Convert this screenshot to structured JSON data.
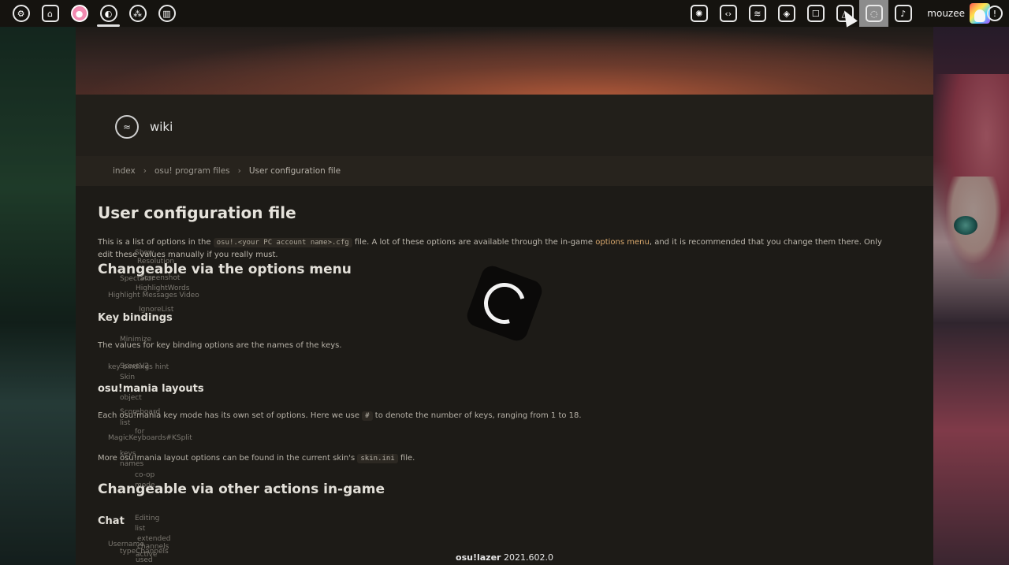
{
  "toolbar": {
    "left_buttons": [
      {
        "name": "settings-button",
        "icon": "gear-icon",
        "glyph": "⚙"
      },
      {
        "name": "home-button",
        "icon": "home-icon",
        "glyph": "⌂"
      },
      {
        "name": "ruleset-osu-button",
        "icon": "osu-ruleset-icon",
        "glyph": "●"
      },
      {
        "name": "ruleset-taiko-button",
        "icon": "taiko-ruleset-icon",
        "glyph": "◐"
      },
      {
        "name": "ruleset-catch-button",
        "icon": "catch-ruleset-icon",
        "glyph": "⁂"
      },
      {
        "name": "ruleset-mania-button",
        "icon": "mania-ruleset-icon",
        "glyph": "▥"
      }
    ],
    "right_buttons": [
      {
        "name": "news-button",
        "icon": "news-icon",
        "glyph": "✺"
      },
      {
        "name": "changelog-button",
        "icon": "changelog-icon",
        "glyph": "‹›"
      },
      {
        "name": "rankings-button",
        "icon": "rankings-icon",
        "glyph": "≋"
      },
      {
        "name": "beatmap-listing-button",
        "icon": "beatmap-listing-icon",
        "glyph": "◈"
      },
      {
        "name": "chat-button",
        "icon": "chat-icon",
        "glyph": "☐"
      },
      {
        "name": "social-button",
        "icon": "social-icon",
        "glyph": "△"
      },
      {
        "name": "wiki-button",
        "icon": "wiki-icon",
        "glyph": "◌"
      },
      {
        "name": "music-button",
        "icon": "music-icon",
        "glyph": "♪"
      }
    ],
    "username": "mouzee",
    "notifications_icon": "!"
  },
  "wiki": {
    "logo_icon": "wiki-logo-icon",
    "title": "wiki",
    "breadcrumb": {
      "items": [
        "index",
        "osu! program files"
      ],
      "current": "User configuration file"
    },
    "page_title": "User configuration file",
    "intro": {
      "before": "This is a list of options in the",
      "code": "osu!.<your PC account name>.cfg",
      "middle": "file. A lot of these options are available through the in-game",
      "link": "options menu",
      "after": ", and it is recommended that you change them there. Only edit these values manually if you really must."
    },
    "sections": {
      "options_menu": "Changeable via the options menu",
      "key_bindings": "Key bindings",
      "key_bindings_text": "The values for key binding options are the names of the keys.",
      "mania_layouts": "osu!mania layouts",
      "mania_text_before": "Each osu!mania key mode has its own set of options. Here we use",
      "mania_code": "#",
      "mania_text_after": "to denote the number of keys, ranging from 1 to 18.",
      "more_mania_before": "More osu!mania layout options can be found in the current skin's",
      "more_mania_code": "skin.ini",
      "more_mania_after": "file.",
      "other_actions": "Changeable via other actions in-game",
      "chat": "Chat"
    },
    "ghost_texts": [
      "Show",
      "Resolution",
      "Screenshot",
      "Spectator",
      "HighlightWords",
      "IgnoreList",
      "Minimize",
      "ScoreV2",
      "Skin",
      "object",
      "Scoreboard",
      "list",
      "for",
      "keys",
      "names",
      "co-op",
      "mode",
      "Editing",
      "list",
      "extended",
      "channels",
      "active",
      "used",
      "Highlight Messages Video",
      "key bindings hint",
      "MagicKeyboards#KSplit",
      "Username",
      "typeChannels"
    ]
  },
  "footer": {
    "app_name": "osu!lazer",
    "version": "2021.602.0"
  }
}
